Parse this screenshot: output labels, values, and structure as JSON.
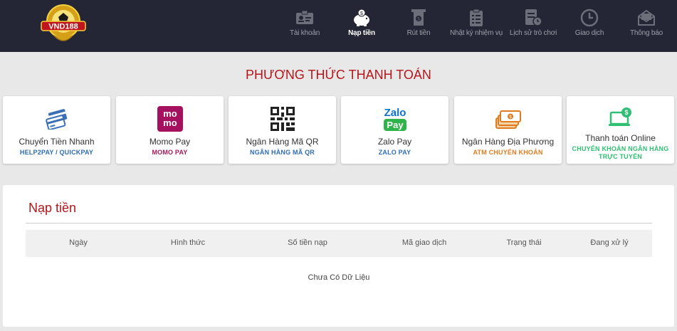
{
  "header": {
    "logo_text": "VND188",
    "nav": [
      {
        "label": "Tài khoản",
        "icon": "id-card-icon",
        "active": false
      },
      {
        "label": "Nạp tiền",
        "icon": "piggy-bank-icon",
        "active": true
      },
      {
        "label": "Rút tiền",
        "icon": "atm-withdraw-icon",
        "active": false
      },
      {
        "label": "Nhật ký nhiệm vụ",
        "icon": "task-list-icon",
        "active": false
      },
      {
        "label": "Lịch sử trò chơi",
        "icon": "history-doc-icon",
        "active": false
      },
      {
        "label": "Giao dịch",
        "icon": "clock-icon",
        "active": false
      },
      {
        "label": "Thông báo",
        "icon": "mail-icon",
        "active": false
      }
    ]
  },
  "payment": {
    "title": "PHƯƠNG THỨC THANH TOÁN",
    "methods": [
      {
        "name": "Chuyển Tiền Nhanh",
        "sub": "HELP2PAY / QUICKPAY",
        "sub_color": "#2f6db5",
        "icon": "credit-cards-icon"
      },
      {
        "name": "Momo Pay",
        "sub": "MOMO PAY",
        "sub_color": "#a3195b",
        "icon": "momo-logo-icon",
        "icon_text_top": "mo",
        "icon_text_bottom": "mo"
      },
      {
        "name": "Ngân Hàng Mã QR",
        "sub": "NGÂN HÀNG MÃ QR",
        "sub_color": "#2f6db5",
        "icon": "qr-code-icon"
      },
      {
        "name": "Zalo Pay",
        "sub": "ZALO PAY",
        "sub_color": "#2f6db5",
        "icon": "zalopay-logo-icon",
        "icon_text_top": "Zalo",
        "icon_text_bottom": "Pay"
      },
      {
        "name": "Ngân Hàng Địa Phương",
        "sub": "ATM CHUYỂN KHOẢN",
        "sub_color": "#e07b1f",
        "icon": "cash-stack-icon"
      },
      {
        "name": "Thanh toán Online",
        "sub": "CHUYỂN KHOẢN NGÂN HÀNG TRỰC TUYẾN",
        "sub_color": "#2fbf73",
        "icon": "laptop-dollar-icon"
      }
    ]
  },
  "deposit": {
    "title": "Nạp tiền",
    "columns": [
      "Ngày",
      "Hình thức",
      "Số tiền nạp",
      "Mã giao dịch",
      "Trạng thái",
      "Đang xử lý"
    ],
    "empty_text": "Chưa Có Dữ Liệu"
  }
}
